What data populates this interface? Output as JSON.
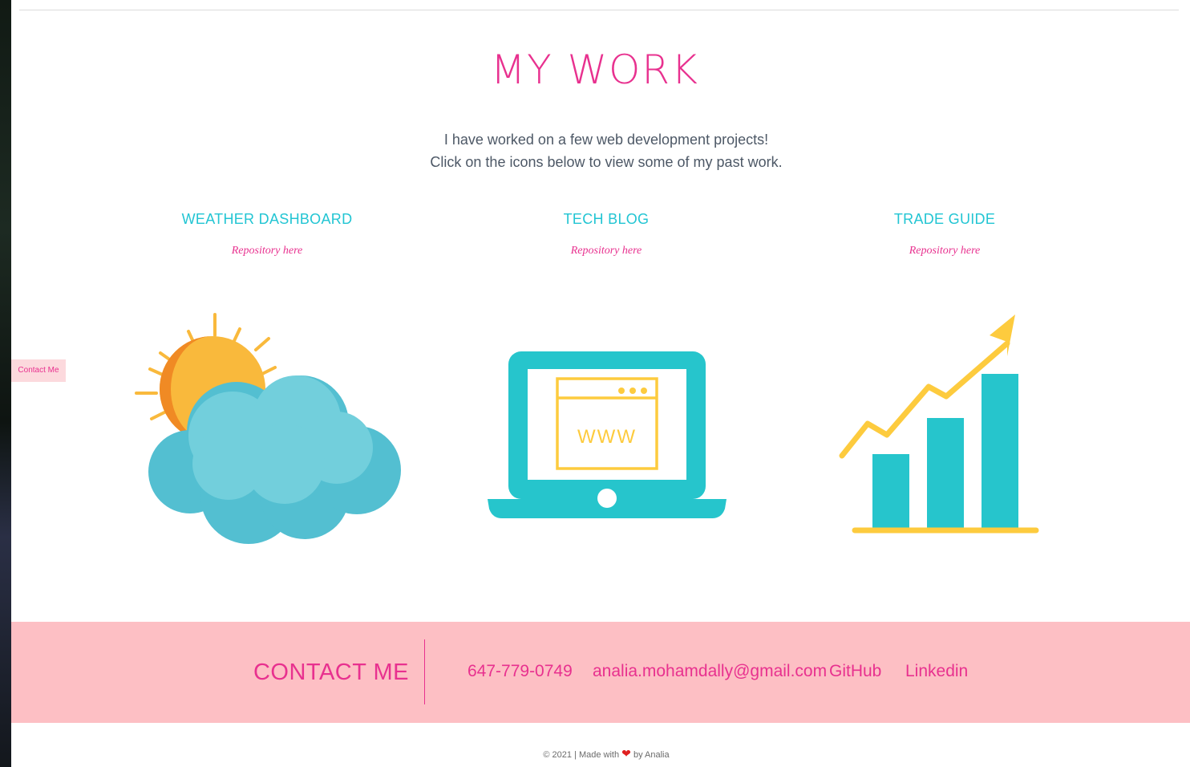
{
  "section": {
    "title": "MY WORK",
    "intro_line1": "I have worked on a few web development projects!",
    "intro_line2": "Click on the icons below to view some of my past work."
  },
  "projects": [
    {
      "name": "WEATHER DASHBOARD",
      "repo_label": "Repository here",
      "icon": "weather-icon"
    },
    {
      "name": "TECH BLOG",
      "repo_label": "Repository here",
      "icon": "laptop-icon"
    },
    {
      "name": "TRADE GUIDE",
      "repo_label": "Repository here",
      "icon": "growth-chart-icon"
    }
  ],
  "laptop_screen_text": "WWW",
  "side_button": {
    "label": "Contact Me"
  },
  "contact": {
    "title": "CONTACT ME",
    "phone": "647-779-0749",
    "email": "analia.mohamdally@gmail.com",
    "github": "GitHub",
    "linkedin": "Linkedin"
  },
  "footer": {
    "prefix": "© 2021 | Made with",
    "suffix": "by Analia"
  },
  "colors": {
    "accent_pink": "#e8318f",
    "accent_cyan": "#22c5d3",
    "band_pink": "#fdbfc4",
    "sun_yellow": "#f9b93c",
    "cloud_blue": "#6ccfdd",
    "chart_yellow": "#fdcb3e"
  }
}
